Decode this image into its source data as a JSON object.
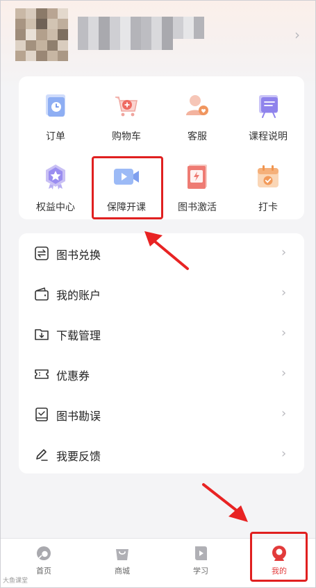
{
  "profile": {
    "avatar_alt": "blurred avatar",
    "name_alt": "blurred user name"
  },
  "grid": [
    {
      "label": "订单",
      "icon": "order-icon"
    },
    {
      "label": "购物车",
      "icon": "shopping-cart-icon"
    },
    {
      "label": "客服",
      "icon": "customer-service-icon"
    },
    {
      "label": "课程说明",
      "icon": "course-intro-icon"
    },
    {
      "label": "权益中心",
      "icon": "benefits-badge-icon"
    },
    {
      "label": "保障开课",
      "icon": "video-camera-icon"
    },
    {
      "label": "图书激活",
      "icon": "book-activate-icon"
    },
    {
      "label": "打卡",
      "icon": "check-in-calendar-icon"
    }
  ],
  "menu": [
    {
      "label": "图书兑换",
      "icon": "exchange-icon"
    },
    {
      "label": "我的账户",
      "icon": "wallet-icon"
    },
    {
      "label": "下载管理",
      "icon": "download-folder-icon"
    },
    {
      "label": "优惠券",
      "icon": "coupon-icon"
    },
    {
      "label": "图书勘误",
      "icon": "book-check-icon"
    },
    {
      "label": "我要反馈",
      "icon": "pencil-icon"
    }
  ],
  "tabs": [
    {
      "label": "首页",
      "icon": "home-icon",
      "active": false
    },
    {
      "label": "商城",
      "icon": "shop-bag-icon",
      "active": false
    },
    {
      "label": "学习",
      "icon": "play-book-icon",
      "active": false
    },
    {
      "label": "我的",
      "icon": "profile-icon",
      "active": true
    }
  ],
  "watermark": "大鱼课堂",
  "colors": {
    "accent_red": "#e23b3b",
    "annotation_red": "#e02020",
    "icon_blue": "#7b9ff0"
  }
}
